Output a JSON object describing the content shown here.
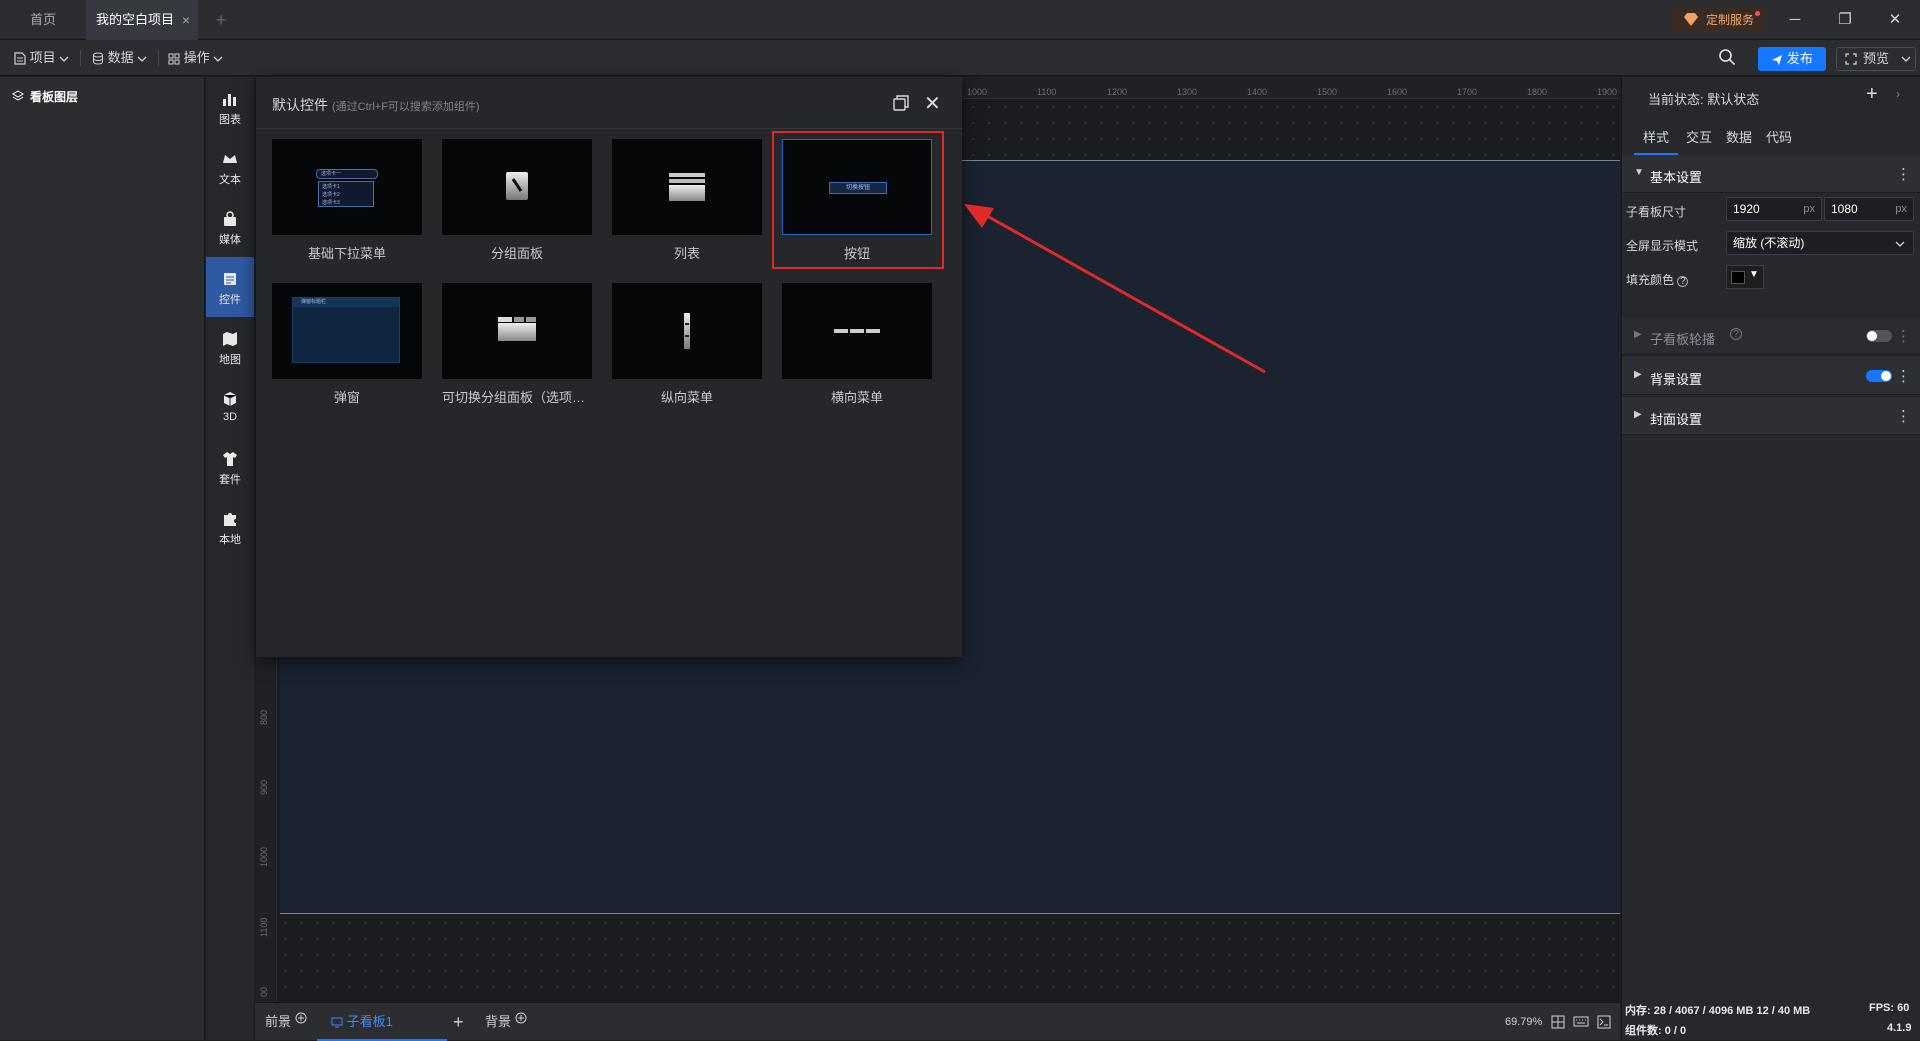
{
  "tabs": {
    "home": "首页",
    "project": "我的空白项目",
    "close": "×",
    "add": "+"
  },
  "custom_service": "定制服务",
  "window": {
    "min": "─",
    "max": "❐",
    "close": "✕"
  },
  "toolbar": {
    "project": "项目",
    "data": "数据",
    "operation": "操作",
    "publish": "发布",
    "preview": "预览"
  },
  "layers": {
    "title": "看板图层"
  },
  "rail": [
    "图表",
    "文本",
    "媒体",
    "控件",
    "地图",
    "3D",
    "套件",
    "本地"
  ],
  "ruler": {
    "top": [
      "1000",
      "1100",
      "1200",
      "1300",
      "1400",
      "1500",
      "1600",
      "1700",
      "1800",
      "1900"
    ],
    "left": [
      "800",
      "900",
      "1000",
      "1100",
      "00"
    ]
  },
  "widget_panel": {
    "title": "默认控件",
    "hint": "(通过Ctrl+F可以搜索添加组件)",
    "items": [
      "基础下拉菜单",
      "分组面板",
      "列表",
      "按钮",
      "弹窗",
      "可切换分组面板（选项卡...",
      "纵向菜单",
      "横向菜单"
    ],
    "thumb_text": {
      "dropdown_title": "选项卡一",
      "dropdown_opts": [
        "选项卡1",
        "选项卡2",
        "选项卡3"
      ],
      "button": "切换按钮",
      "popup": "弹窗标题栏"
    }
  },
  "bottom": {
    "front": "前景",
    "sub_board": "子看板1",
    "add": "+",
    "background": "背景",
    "zoom": "69.79%"
  },
  "right_panel": {
    "state_label": "当前状态:",
    "state_value": "默认状态",
    "add": "+",
    "tabs": [
      "样式",
      "交互",
      "数据",
      "代码"
    ],
    "sections": {
      "basic": "基本设置",
      "carousel": "子看板轮播",
      "bg": "背景设置",
      "cover": "封面设置"
    },
    "props": {
      "size_label": "子看板尺寸",
      "width": "1920",
      "height": "1080",
      "unit": "px",
      "mode_label": "全屏显示模式",
      "mode_value": "缩放 (不滚动)",
      "fill_label": "填充颜色"
    },
    "toggles": {
      "carousel": false,
      "bg": true
    }
  },
  "status": {
    "memory": "内存: 28 / 4067 / 4096 MB  12 / 40 MB",
    "fps": "FPS: 60",
    "components": "组件数: 0 / 0",
    "version": "4.1.9"
  },
  "colors": {
    "accent": "#1677ff",
    "highlight": "#e02a2a",
    "arrow": "#e02a2a"
  }
}
